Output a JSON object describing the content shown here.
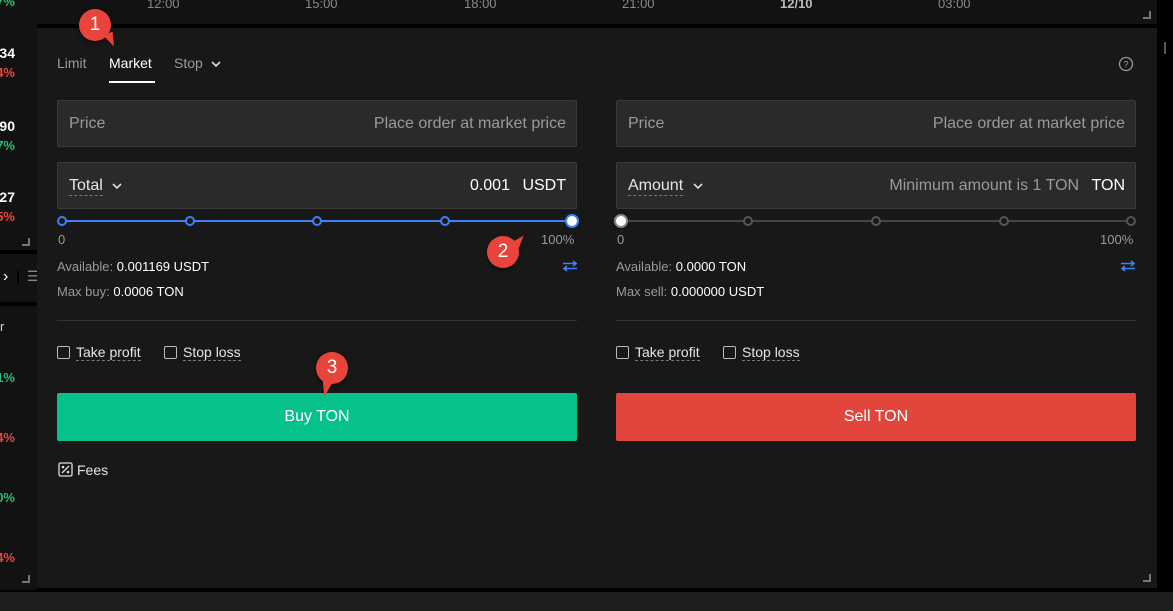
{
  "left_strip": {
    "rows": [
      {
        "value": "34",
        "pct": "4%",
        "pct_color": "red"
      },
      {
        "value": "90",
        "pct": "7%",
        "pct_color": "green"
      },
      {
        "value": "27",
        "pct": "5%",
        "pct_color": "red"
      }
    ],
    "top_pct": "7%",
    "section_label": "r",
    "arrow": "›",
    "pcts2": [
      {
        "pct": "1%",
        "color": "green"
      },
      {
        "pct": "4%",
        "color": "red"
      },
      {
        "pct": "0%",
        "color": "green"
      },
      {
        "pct": "4%",
        "color": "red"
      }
    ]
  },
  "chart": {
    "ticks": [
      "12:00",
      "15:00",
      "18:00",
      "21:00",
      "12/10",
      "03:00"
    ]
  },
  "tabs": {
    "limit": "Limit",
    "market": "Market",
    "stop": "Stop",
    "active": "Market"
  },
  "buy": {
    "price_label": "Price",
    "price_placeholder": "Place order at market price",
    "total_label": "Total",
    "total_value": "0.001",
    "total_unit": "USDT",
    "slider_min": "0",
    "slider_max": "100%",
    "slider_percent": 100,
    "available_label": "Available:",
    "available_value": "0.001169 USDT",
    "max_label": "Max buy:",
    "max_value": "0.0006 TON",
    "take_profit": "Take profit",
    "stop_loss": "Stop loss",
    "button": "Buy TON",
    "fees": "Fees"
  },
  "sell": {
    "price_label": "Price",
    "price_placeholder": "Place order at market price",
    "amount_label": "Amount",
    "amount_placeholder": "Minimum amount is 1 TON",
    "amount_unit": "TON",
    "slider_min": "0",
    "slider_max": "100%",
    "slider_percent": 0,
    "available_label": "Available:",
    "available_value": "0.0000 TON",
    "max_label": "Max sell:",
    "max_value": "0.000000 USDT",
    "take_profit": "Take profit",
    "stop_loss": "Stop loss",
    "button": "Sell TON"
  },
  "markers": [
    "1",
    "2",
    "3"
  ],
  "colors": {
    "buy": "#07c18d",
    "sell": "#e0463c",
    "slider_active": "#3b82f6",
    "marker": "#e9443b"
  },
  "icons": {
    "help": "help-circle-icon",
    "swap": "swap-arrows-icon",
    "fees": "percent-icon",
    "chevron": "chevron-down-icon"
  }
}
